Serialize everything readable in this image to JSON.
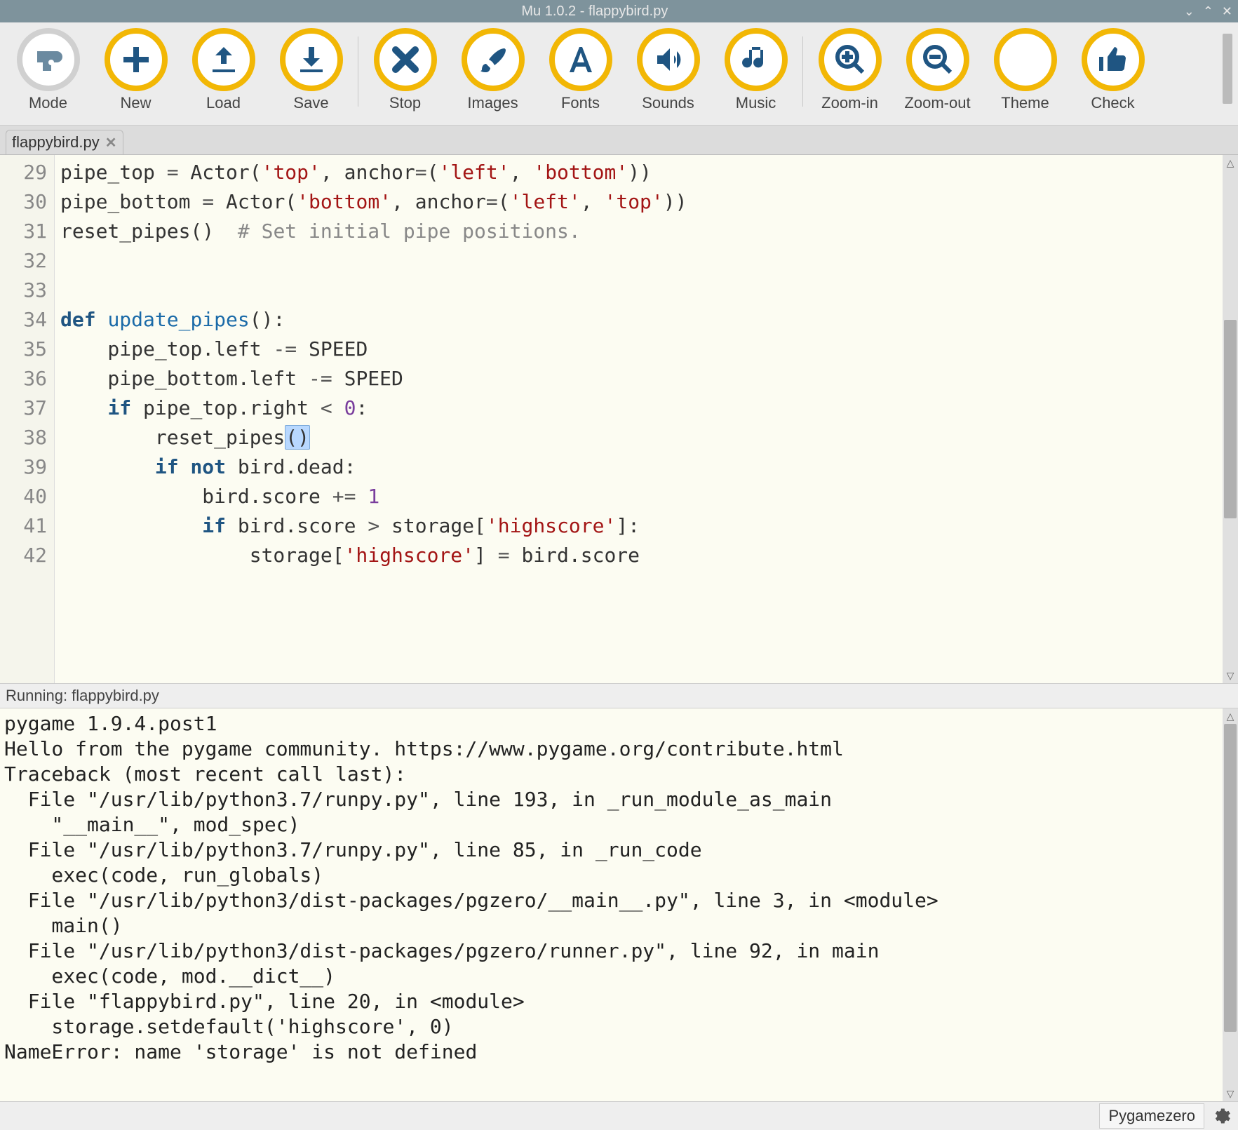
{
  "window": {
    "title": "Mu 1.0.2 - flappybird.py"
  },
  "toolbar": [
    {
      "id": "mode",
      "label": "Mode",
      "icon": "cog-blob"
    },
    {
      "id": "new",
      "label": "New",
      "icon": "plus"
    },
    {
      "id": "load",
      "label": "Load",
      "icon": "upload"
    },
    {
      "id": "save",
      "label": "Save",
      "icon": "download"
    },
    {
      "sep": true
    },
    {
      "id": "stop",
      "label": "Stop",
      "icon": "cross"
    },
    {
      "id": "images",
      "label": "Images",
      "icon": "brush"
    },
    {
      "id": "fonts",
      "label": "Fonts",
      "icon": "font-a"
    },
    {
      "id": "sounds",
      "label": "Sounds",
      "icon": "speaker"
    },
    {
      "id": "music",
      "label": "Music",
      "icon": "music-note"
    },
    {
      "sep": true
    },
    {
      "id": "zoom-in",
      "label": "Zoom-in",
      "icon": "zoom-in"
    },
    {
      "id": "zoom-out",
      "label": "Zoom-out",
      "icon": "zoom-out"
    },
    {
      "id": "theme",
      "label": "Theme",
      "icon": "moon"
    },
    {
      "id": "check",
      "label": "Check",
      "icon": "thumb-up"
    }
  ],
  "tabs": [
    {
      "label": "flappybird.py"
    }
  ],
  "editor": {
    "first_line": 29,
    "lines": [
      {
        "n": 29,
        "html": "pipe_top <span class='op'>=</span> Actor(<span class='str'>'top'</span>, anchor<span class='op'>=</span>(<span class='str'>'left'</span>, <span class='str'>'bottom'</span>))"
      },
      {
        "n": 30,
        "html": "pipe_bottom <span class='op'>=</span> Actor(<span class='str'>'bottom'</span>, anchor<span class='op'>=</span>(<span class='str'>'left'</span>, <span class='str'>'top'</span>))"
      },
      {
        "n": 31,
        "html": "reset_pipes()  <span class='cmt'># Set initial pipe positions.</span>"
      },
      {
        "n": 32,
        "html": ""
      },
      {
        "n": 33,
        "html": ""
      },
      {
        "n": 34,
        "html": "<span class='kw'>def</span> <span class='fn'>update_pipes</span>():"
      },
      {
        "n": 35,
        "html": "    pipe_top.left <span class='op'>-=</span> SPEED"
      },
      {
        "n": 36,
        "html": "    pipe_bottom.left <span class='op'>-=</span> SPEED"
      },
      {
        "n": 37,
        "html": "    <span class='kw'>if</span> pipe_top.right <span class='op'>&lt;</span> <span class='num'>0</span>:"
      },
      {
        "n": 38,
        "html": "        reset_pipes<span class='hl'>()</span>"
      },
      {
        "n": 39,
        "html": "        <span class='kw'>if</span> <span class='kw'>not</span> bird.dead:"
      },
      {
        "n": 40,
        "html": "            bird.score <span class='op'>+=</span> <span class='num'>1</span>"
      },
      {
        "n": 41,
        "html": "            <span class='kw'>if</span> bird.score <span class='op'>&gt;</span> storage[<span class='str'>'highscore'</span>]:"
      },
      {
        "n": 42,
        "html": "                storage[<span class='str'>'highscore'</span>] <span class='op'>=</span> bird.score"
      }
    ]
  },
  "running": {
    "label": "Running: flappybird.py"
  },
  "console": {
    "lines": [
      "pygame 1.9.4.post1",
      "Hello from the pygame community. https://www.pygame.org/contribute.html",
      "Traceback (most recent call last):",
      "  File \"/usr/lib/python3.7/runpy.py\", line 193, in _run_module_as_main",
      "    \"__main__\", mod_spec)",
      "  File \"/usr/lib/python3.7/runpy.py\", line 85, in _run_code",
      "    exec(code, run_globals)",
      "  File \"/usr/lib/python3/dist-packages/pgzero/__main__.py\", line 3, in <module>",
      "    main()",
      "  File \"/usr/lib/python3/dist-packages/pgzero/runner.py\", line 92, in main",
      "    exec(code, mod.__dict__)",
      "  File \"flappybird.py\", line 20, in <module>",
      "    storage.setdefault('highscore', 0)",
      "NameError: name 'storage' is not defined"
    ]
  },
  "statusbar": {
    "mode": "Pygamezero"
  }
}
